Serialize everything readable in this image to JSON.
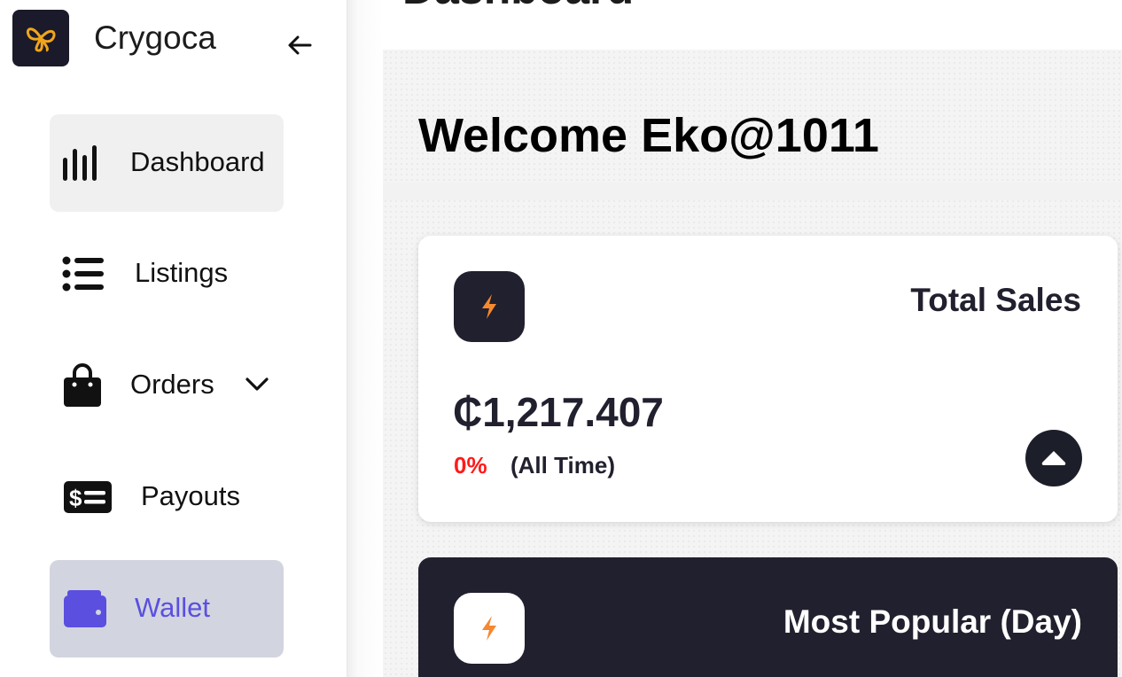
{
  "sidebar": {
    "brand": "Crygoca",
    "logo_icon": "butterfly-logo-icon",
    "collapse_icon": "arrow-left-icon",
    "items": [
      {
        "label": "Dashboard",
        "icon": "bar-chart-icon"
      },
      {
        "label": "Listings",
        "icon": "list-icon"
      },
      {
        "label": "Orders",
        "icon": "shopping-bag-icon",
        "chevron": "chevron-down-icon"
      },
      {
        "label": "Payouts",
        "icon": "money-bill-icon"
      },
      {
        "label": "Wallet",
        "icon": "wallet-icon",
        "active": true
      }
    ]
  },
  "header": {
    "title": "Dashboard"
  },
  "main": {
    "welcome": "Welcome Eko@1011",
    "cards": [
      {
        "title": "Total Sales",
        "icon": "lightning-icon",
        "amount": "₵1,217.407",
        "change": "0%",
        "period": "(All Time)",
        "action_icon": "caret-up-icon"
      },
      {
        "title": "Most Popular (Day)",
        "icon": "lightning-icon"
      }
    ]
  },
  "colors": {
    "dark": "#21202e",
    "accent": "#f7882f",
    "wallet_active": "#5b4fe0",
    "negative": "#ff1a1a"
  }
}
